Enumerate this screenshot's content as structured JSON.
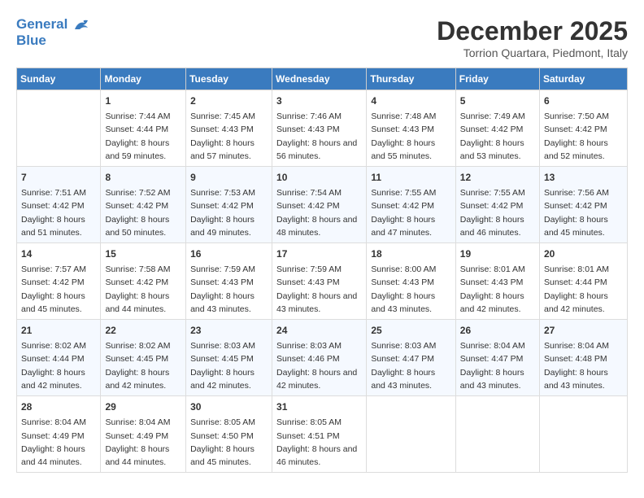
{
  "header": {
    "logo_line1": "General",
    "logo_line2": "Blue",
    "month": "December 2025",
    "location": "Torrion Quartara, Piedmont, Italy"
  },
  "days_of_week": [
    "Sunday",
    "Monday",
    "Tuesday",
    "Wednesday",
    "Thursday",
    "Friday",
    "Saturday"
  ],
  "weeks": [
    [
      {
        "day": "",
        "sunrise": "",
        "sunset": "",
        "daylight": ""
      },
      {
        "day": "1",
        "sunrise": "Sunrise: 7:44 AM",
        "sunset": "Sunset: 4:44 PM",
        "daylight": "Daylight: 8 hours and 59 minutes."
      },
      {
        "day": "2",
        "sunrise": "Sunrise: 7:45 AM",
        "sunset": "Sunset: 4:43 PM",
        "daylight": "Daylight: 8 hours and 57 minutes."
      },
      {
        "day": "3",
        "sunrise": "Sunrise: 7:46 AM",
        "sunset": "Sunset: 4:43 PM",
        "daylight": "Daylight: 8 hours and 56 minutes."
      },
      {
        "day": "4",
        "sunrise": "Sunrise: 7:48 AM",
        "sunset": "Sunset: 4:43 PM",
        "daylight": "Daylight: 8 hours and 55 minutes."
      },
      {
        "day": "5",
        "sunrise": "Sunrise: 7:49 AM",
        "sunset": "Sunset: 4:42 PM",
        "daylight": "Daylight: 8 hours and 53 minutes."
      },
      {
        "day": "6",
        "sunrise": "Sunrise: 7:50 AM",
        "sunset": "Sunset: 4:42 PM",
        "daylight": "Daylight: 8 hours and 52 minutes."
      }
    ],
    [
      {
        "day": "7",
        "sunrise": "Sunrise: 7:51 AM",
        "sunset": "Sunset: 4:42 PM",
        "daylight": "Daylight: 8 hours and 51 minutes."
      },
      {
        "day": "8",
        "sunrise": "Sunrise: 7:52 AM",
        "sunset": "Sunset: 4:42 PM",
        "daylight": "Daylight: 8 hours and 50 minutes."
      },
      {
        "day": "9",
        "sunrise": "Sunrise: 7:53 AM",
        "sunset": "Sunset: 4:42 PM",
        "daylight": "Daylight: 8 hours and 49 minutes."
      },
      {
        "day": "10",
        "sunrise": "Sunrise: 7:54 AM",
        "sunset": "Sunset: 4:42 PM",
        "daylight": "Daylight: 8 hours and 48 minutes."
      },
      {
        "day": "11",
        "sunrise": "Sunrise: 7:55 AM",
        "sunset": "Sunset: 4:42 PM",
        "daylight": "Daylight: 8 hours and 47 minutes."
      },
      {
        "day": "12",
        "sunrise": "Sunrise: 7:55 AM",
        "sunset": "Sunset: 4:42 PM",
        "daylight": "Daylight: 8 hours and 46 minutes."
      },
      {
        "day": "13",
        "sunrise": "Sunrise: 7:56 AM",
        "sunset": "Sunset: 4:42 PM",
        "daylight": "Daylight: 8 hours and 45 minutes."
      }
    ],
    [
      {
        "day": "14",
        "sunrise": "Sunrise: 7:57 AM",
        "sunset": "Sunset: 4:42 PM",
        "daylight": "Daylight: 8 hours and 45 minutes."
      },
      {
        "day": "15",
        "sunrise": "Sunrise: 7:58 AM",
        "sunset": "Sunset: 4:42 PM",
        "daylight": "Daylight: 8 hours and 44 minutes."
      },
      {
        "day": "16",
        "sunrise": "Sunrise: 7:59 AM",
        "sunset": "Sunset: 4:43 PM",
        "daylight": "Daylight: 8 hours and 43 minutes."
      },
      {
        "day": "17",
        "sunrise": "Sunrise: 7:59 AM",
        "sunset": "Sunset: 4:43 PM",
        "daylight": "Daylight: 8 hours and 43 minutes."
      },
      {
        "day": "18",
        "sunrise": "Sunrise: 8:00 AM",
        "sunset": "Sunset: 4:43 PM",
        "daylight": "Daylight: 8 hours and 43 minutes."
      },
      {
        "day": "19",
        "sunrise": "Sunrise: 8:01 AM",
        "sunset": "Sunset: 4:43 PM",
        "daylight": "Daylight: 8 hours and 42 minutes."
      },
      {
        "day": "20",
        "sunrise": "Sunrise: 8:01 AM",
        "sunset": "Sunset: 4:44 PM",
        "daylight": "Daylight: 8 hours and 42 minutes."
      }
    ],
    [
      {
        "day": "21",
        "sunrise": "Sunrise: 8:02 AM",
        "sunset": "Sunset: 4:44 PM",
        "daylight": "Daylight: 8 hours and 42 minutes."
      },
      {
        "day": "22",
        "sunrise": "Sunrise: 8:02 AM",
        "sunset": "Sunset: 4:45 PM",
        "daylight": "Daylight: 8 hours and 42 minutes."
      },
      {
        "day": "23",
        "sunrise": "Sunrise: 8:03 AM",
        "sunset": "Sunset: 4:45 PM",
        "daylight": "Daylight: 8 hours and 42 minutes."
      },
      {
        "day": "24",
        "sunrise": "Sunrise: 8:03 AM",
        "sunset": "Sunset: 4:46 PM",
        "daylight": "Daylight: 8 hours and 42 minutes."
      },
      {
        "day": "25",
        "sunrise": "Sunrise: 8:03 AM",
        "sunset": "Sunset: 4:47 PM",
        "daylight": "Daylight: 8 hours and 43 minutes."
      },
      {
        "day": "26",
        "sunrise": "Sunrise: 8:04 AM",
        "sunset": "Sunset: 4:47 PM",
        "daylight": "Daylight: 8 hours and 43 minutes."
      },
      {
        "day": "27",
        "sunrise": "Sunrise: 8:04 AM",
        "sunset": "Sunset: 4:48 PM",
        "daylight": "Daylight: 8 hours and 43 minutes."
      }
    ],
    [
      {
        "day": "28",
        "sunrise": "Sunrise: 8:04 AM",
        "sunset": "Sunset: 4:49 PM",
        "daylight": "Daylight: 8 hours and 44 minutes."
      },
      {
        "day": "29",
        "sunrise": "Sunrise: 8:04 AM",
        "sunset": "Sunset: 4:49 PM",
        "daylight": "Daylight: 8 hours and 44 minutes."
      },
      {
        "day": "30",
        "sunrise": "Sunrise: 8:05 AM",
        "sunset": "Sunset: 4:50 PM",
        "daylight": "Daylight: 8 hours and 45 minutes."
      },
      {
        "day": "31",
        "sunrise": "Sunrise: 8:05 AM",
        "sunset": "Sunset: 4:51 PM",
        "daylight": "Daylight: 8 hours and 46 minutes."
      },
      {
        "day": "",
        "sunrise": "",
        "sunset": "",
        "daylight": ""
      },
      {
        "day": "",
        "sunrise": "",
        "sunset": "",
        "daylight": ""
      },
      {
        "day": "",
        "sunrise": "",
        "sunset": "",
        "daylight": ""
      }
    ]
  ]
}
